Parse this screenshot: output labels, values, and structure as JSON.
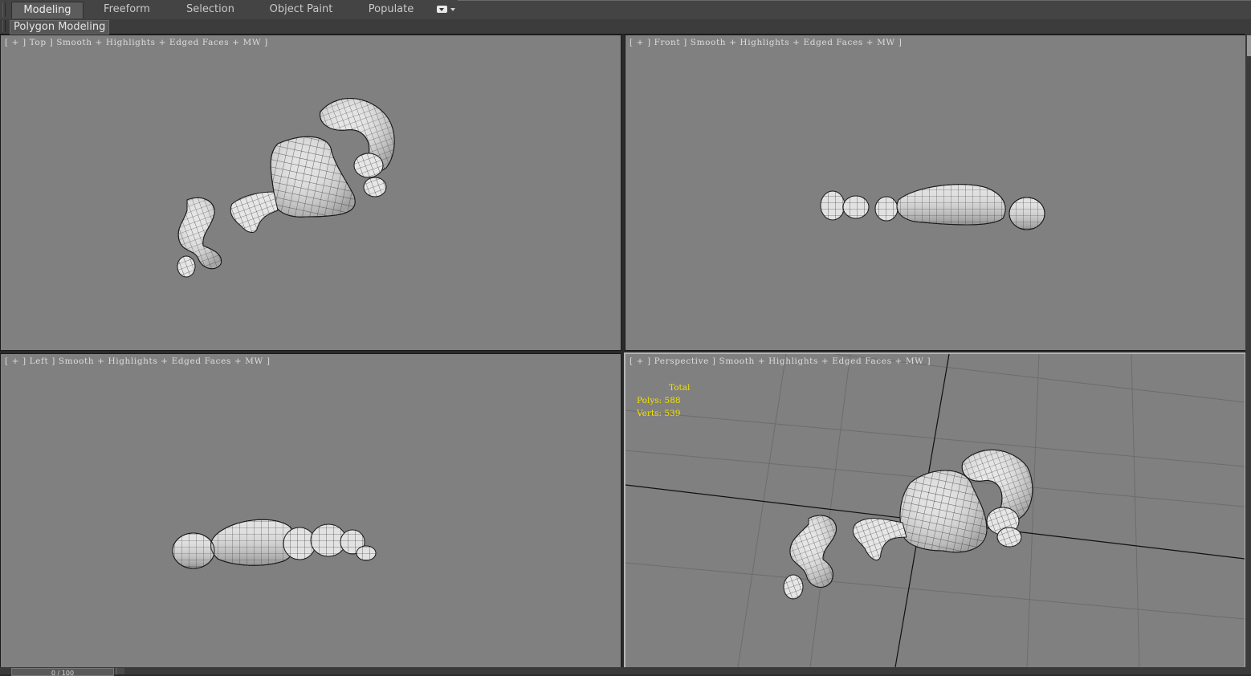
{
  "ribbon": {
    "tabs": [
      {
        "label": "Modeling",
        "active": true
      },
      {
        "label": "Freeform",
        "active": false
      },
      {
        "label": "Selection",
        "active": false
      },
      {
        "label": "Object Paint",
        "active": false
      },
      {
        "label": "Populate",
        "active": false
      }
    ],
    "dropdown_icon": "chevron-down-icon"
  },
  "subpanel": {
    "label": "Polygon Modeling"
  },
  "viewports": {
    "top": {
      "label": "[ + ] Top ] Smooth + Highlights + Edged Faces + MW ]"
    },
    "front": {
      "label": "[ + ] Front ] Smooth + Highlights + Edged Faces + MW ]"
    },
    "left": {
      "label": "[ + ] Left ] Smooth + Highlights + Edged Faces + MW ]"
    },
    "perspective": {
      "label": "[ + ] Perspective ] Smooth + Highlights + Edged Faces + MW ]"
    }
  },
  "stats": {
    "header": "Total",
    "polys_label": "Polys:",
    "polys_value": "588",
    "verts_label": "Verts:",
    "verts_value": "539",
    "color": "#f2e000"
  },
  "time_slider": {
    "label": "0 / 100"
  },
  "colors": {
    "viewport_bg": "#808080",
    "mesh_fill": "#e6e6e6",
    "wire": "#1a1a1a",
    "ui_dark": "#444444"
  }
}
